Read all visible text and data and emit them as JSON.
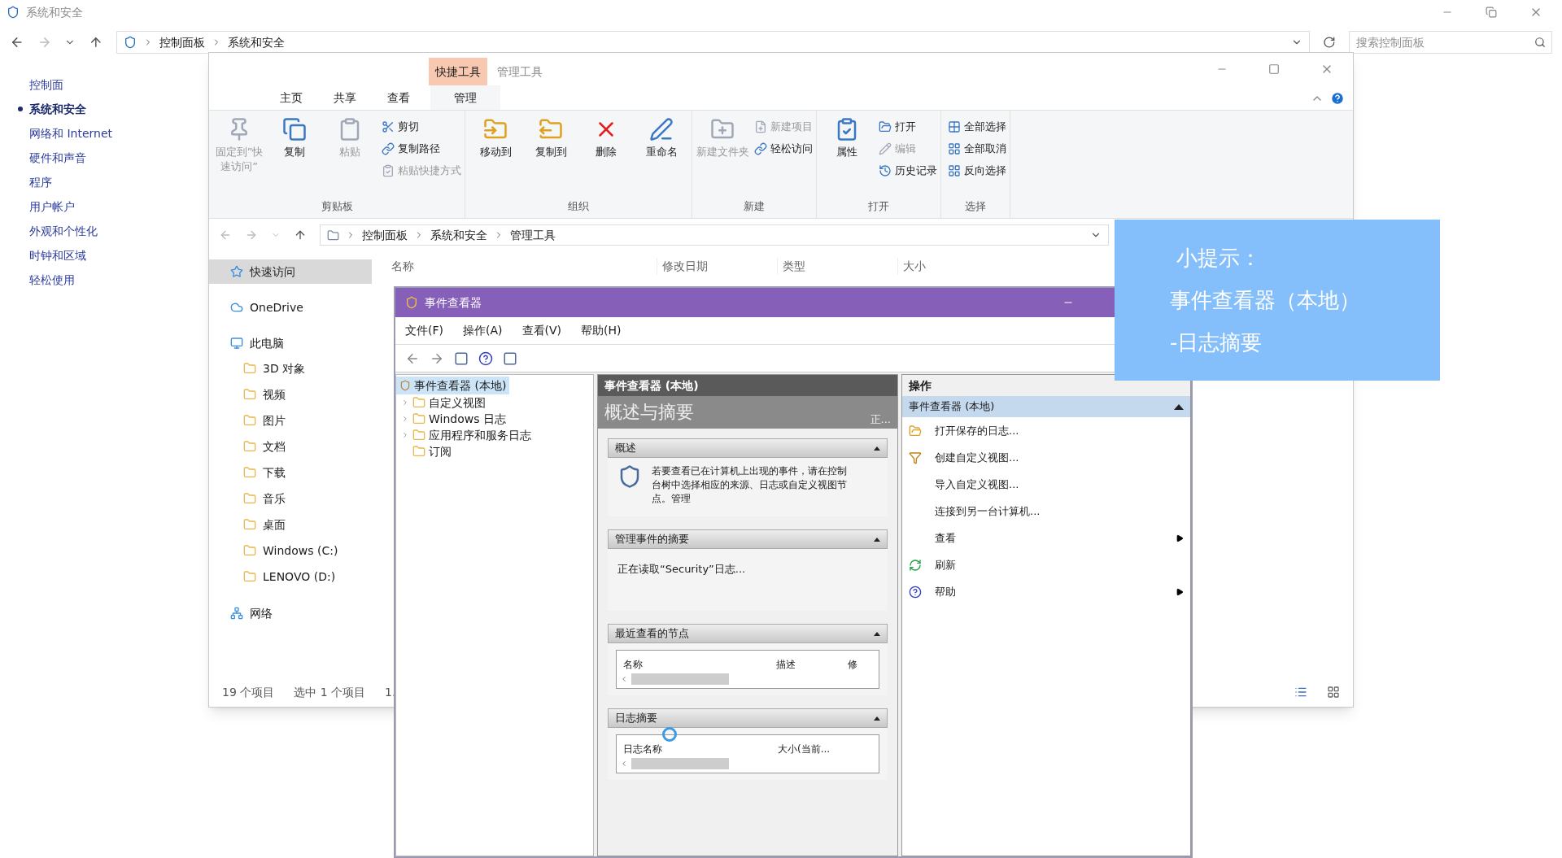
{
  "control_panel": {
    "title": "系统和安全",
    "breadcrumb": [
      "控制面板",
      "系统和安全"
    ],
    "search": {
      "placeholder": "搜索控制面板"
    },
    "nav": [
      {
        "label": "控制面",
        "selected": false
      },
      {
        "label": "系统和安全",
        "selected": true
      },
      {
        "label": "网络和 Internet",
        "selected": false
      },
      {
        "label": "硬件和声音",
        "selected": false
      },
      {
        "label": "程序",
        "selected": false
      },
      {
        "label": "用户帐户",
        "selected": false
      },
      {
        "label": "外观和个性化",
        "selected": false
      },
      {
        "label": "时钟和区域",
        "selected": false
      },
      {
        "label": "轻松使用",
        "selected": false
      }
    ]
  },
  "explorer": {
    "context_tabs": [
      {
        "label": "快捷工具",
        "selected": true
      },
      {
        "label": "管理工具",
        "selected": false
      }
    ],
    "tabs": [
      {
        "label": "主页"
      },
      {
        "label": "共享"
      },
      {
        "label": "查看"
      },
      {
        "label": "管理"
      }
    ],
    "ribbon_groups": [
      {
        "label": "剪贴板",
        "items": [
          {
            "kind": "large",
            "label": "固定到”快速访问”",
            "disabled": true
          },
          {
            "kind": "large",
            "label": "复制",
            "disabled": false
          },
          {
            "kind": "large",
            "label": "粘贴",
            "disabled": true
          },
          {
            "kind": "small",
            "label": "剪切",
            "disabled": false
          },
          {
            "kind": "small",
            "label": "复制路径",
            "disabled": false
          },
          {
            "kind": "small",
            "label": "粘贴快捷方式",
            "disabled": true
          }
        ]
      },
      {
        "label": "组织",
        "items": [
          {
            "kind": "large",
            "label": "移动到",
            "disabled": false
          },
          {
            "kind": "large",
            "label": "复制到",
            "disabled": false
          },
          {
            "kind": "large",
            "label": "删除",
            "disabled": false
          },
          {
            "kind": "large",
            "label": "重命名",
            "disabled": false
          }
        ]
      },
      {
        "label": "新建",
        "items": [
          {
            "kind": "large",
            "label": "新建文件夹",
            "disabled": true
          },
          {
            "kind": "small",
            "label": "新建项目",
            "disabled": true
          },
          {
            "kind": "small",
            "label": "轻松访问",
            "disabled": false
          }
        ]
      },
      {
        "label": "打开",
        "items": [
          {
            "kind": "large",
            "label": "属性",
            "disabled": false
          },
          {
            "kind": "small",
            "label": "打开",
            "disabled": false
          },
          {
            "kind": "small",
            "label": "编辑",
            "disabled": true
          },
          {
            "kind": "small",
            "label": "历史记录",
            "disabled": false
          }
        ]
      },
      {
        "label": "选择",
        "items": [
          {
            "kind": "small",
            "label": "全部选择",
            "disabled": false
          },
          {
            "kind": "small",
            "label": "全部取消",
            "disabled": false
          },
          {
            "kind": "small",
            "label": "反向选择",
            "disabled": false
          }
        ]
      }
    ],
    "breadcrumb": [
      "控制面板",
      "系统和安全",
      "管理工具"
    ],
    "columns": [
      "名称",
      "修改日期",
      "类型",
      "大小"
    ],
    "nav": [
      {
        "label": "快速访问",
        "selected": true
      },
      {
        "label": "OneDrive",
        "selected": false
      },
      {
        "label": "此电脑",
        "selected": false,
        "children": [
          {
            "label": "3D 对象",
            "selected": false
          },
          {
            "label": "视频",
            "selected": false
          },
          {
            "label": "图片",
            "selected": false
          },
          {
            "label": "文档",
            "selected": false
          },
          {
            "label": "下载",
            "selected": false
          },
          {
            "label": "音乐",
            "selected": false
          },
          {
            "label": "桌面",
            "selected": false
          },
          {
            "label": "Windows (C:)",
            "selected": false
          },
          {
            "label": "LENOVO (D:)",
            "selected": false
          }
        ]
      },
      {
        "label": "网络",
        "selected": false
      }
    ],
    "status": [
      "19 个项目",
      "选中 1 个项目",
      "1."
    ]
  },
  "event_viewer": {
    "title": "事件查看器",
    "menu": [
      "文件(F)",
      "操作(A)",
      "查看(V)",
      "帮助(H)"
    ],
    "tree": [
      {
        "label": "事件查看器 (本地)",
        "selected": true,
        "children": [
          {
            "label": "自定义视图",
            "expandable": true
          },
          {
            "label": "Windows 日志",
            "expandable": true
          },
          {
            "label": "应用程序和服务日志",
            "expandable": true
          },
          {
            "label": "订阅",
            "expandable": false
          }
        ]
      }
    ],
    "center": {
      "header": "事件查看器 (本地)",
      "banner": "概述与摘要",
      "banner_note": "正...",
      "sections": [
        {
          "title": "概述",
          "expanded": true,
          "kind": "text",
          "text": "若要查看已在计算机上出现的事件，请在控制台树中选择相应的来源、日志或自定义视图节点。管理"
        },
        {
          "title": "管理事件的摘要",
          "expanded": true,
          "kind": "status",
          "text": "正在读取“Security”日志..."
        },
        {
          "title": "最近查看的节点",
          "expanded": true,
          "kind": "table",
          "columns": [
            "名称",
            "描述",
            "修"
          ]
        },
        {
          "title": "日志摘要",
          "expanded": true,
          "kind": "table",
          "columns": [
            "日志名称",
            "大小(当前..."
          ]
        }
      ]
    },
    "actions": {
      "header": "操作",
      "group": "事件查看器 (本地)",
      "items": [
        {
          "label": "打开保存的日志...",
          "kind": "open",
          "submenu": false
        },
        {
          "label": "创建自定义视图...",
          "kind": "filter",
          "submenu": false
        },
        {
          "label": "导入自定义视图...",
          "kind": "plain",
          "submenu": false
        },
        {
          "label": "连接到另一台计算机...",
          "kind": "plain",
          "submenu": false
        },
        {
          "label": "查看",
          "kind": "plain",
          "submenu": true
        },
        {
          "label": "刷新",
          "kind": "refresh",
          "submenu": false
        },
        {
          "label": "帮助",
          "kind": "help",
          "submenu": true
        }
      ]
    }
  },
  "tip": {
    "lines": [
      "小提示：",
      "事件查看器（本地）",
      "-日志摘要"
    ]
  }
}
